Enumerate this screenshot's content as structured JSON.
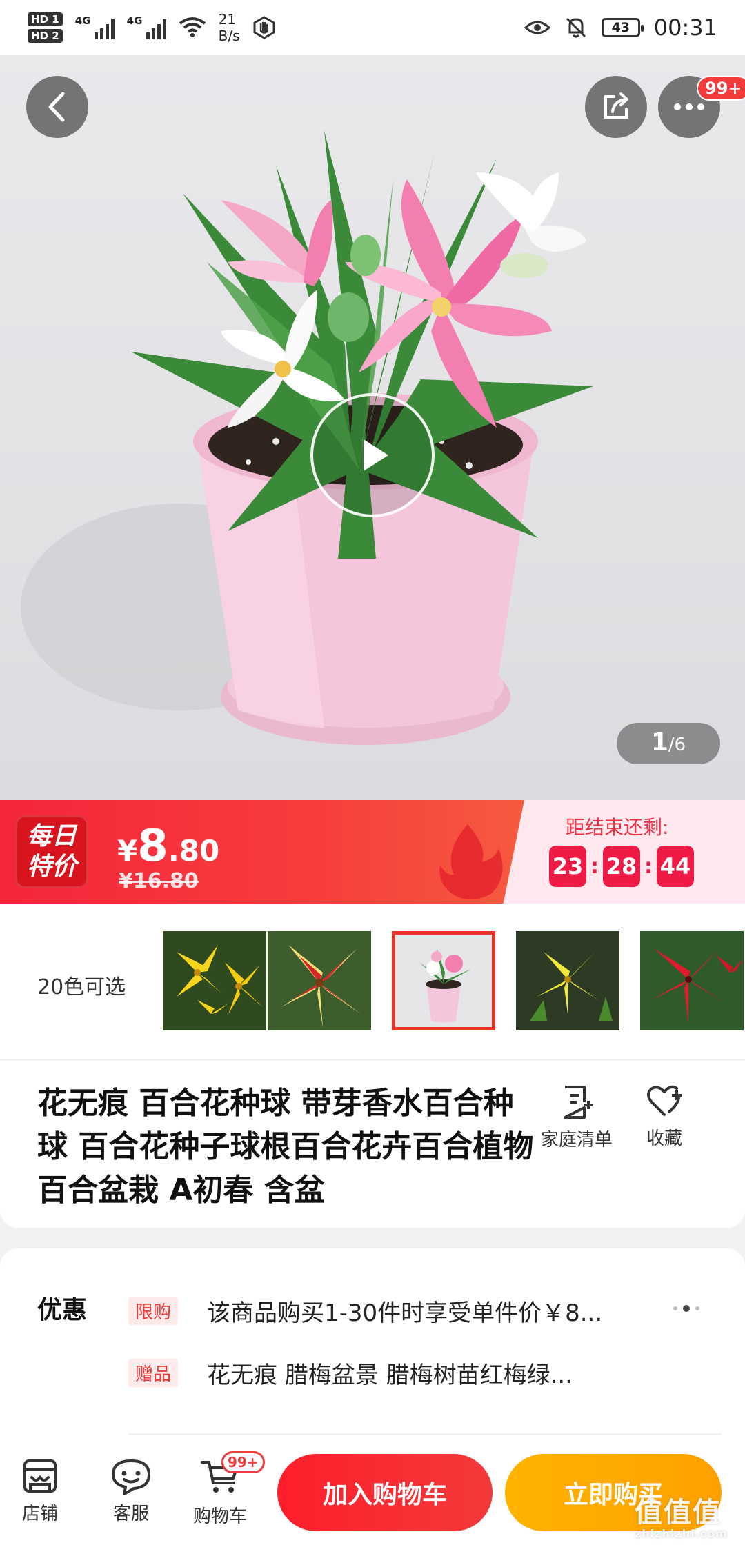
{
  "status_bar": {
    "network_speed_value": "21",
    "network_speed_unit": "B/s",
    "battery": "43",
    "time": "00:31",
    "signal_type_1": "4G",
    "signal_type_2": "4G",
    "hd_1": "HD 1",
    "hd_2": "HD 2"
  },
  "hero": {
    "cart_count_badge": "99+",
    "image_index": "1",
    "image_total": "/6",
    "icons": [
      "back-arrow-icon",
      "share-icon",
      "more-icon",
      "play-icon"
    ]
  },
  "flash_sale": {
    "badge_line1": "每日",
    "badge_line2": "特价",
    "price_symbol": "¥",
    "price_int": "8",
    "price_dec": ".80",
    "original_price": "¥16.80",
    "countdown_label": "距结束还剩:",
    "countdown": [
      "23",
      "28",
      "44"
    ],
    "accent_color": "#f4263a",
    "countdown_color": "#ef1b46"
  },
  "colors": {
    "label": "20色可选",
    "selected_index": 2
  },
  "product": {
    "title": "花无痕 百合花种球 带芽香水百合种球 百合花种子球根百合花卉百合植物百合盆栽 A初春 含盆",
    "actions": [
      {
        "label": "家庭清单",
        "icon": "list-add-icon"
      },
      {
        "label": "收藏",
        "icon": "heart-add-icon"
      }
    ]
  },
  "promotions": {
    "label": "优惠",
    "items": [
      {
        "tag": "限购",
        "text": "该商品购买1-30件时享受单件价￥8..."
      },
      {
        "tag": "赠品",
        "text": "花无痕 腊梅盆景 腊梅树苗红梅绿..."
      }
    ]
  },
  "bottom_bar": {
    "nav": [
      {
        "label": "店铺",
        "icon": "store-icon"
      },
      {
        "label": "客服",
        "icon": "chat-icon"
      },
      {
        "label": "购物车",
        "icon": "cart-icon",
        "badge": "99+"
      }
    ],
    "add_to_cart": "加入购物车",
    "buy_now": "立即购买"
  },
  "watermark": {
    "text": "值值值",
    "url": "zhizhizhi.com"
  }
}
